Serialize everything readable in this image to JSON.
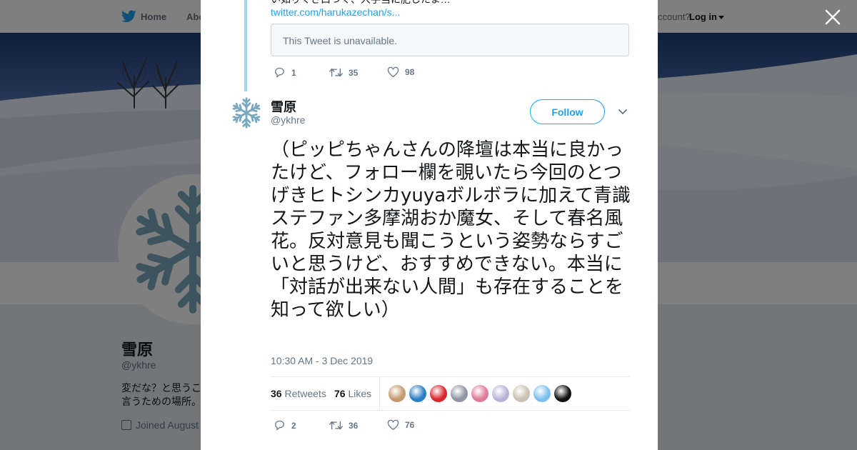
{
  "topbar": {
    "home_label": "Home",
    "about_label": "Abo",
    "account_text": "ccount?",
    "login_label": "Log in"
  },
  "profile": {
    "name": "雪原",
    "handle": "@ykhre",
    "bio": "変だな？と思うこ\n言うための場所。",
    "joined": "Joined August"
  },
  "previous_tweet": {
    "text_partial": "い如りくさ口つく、人手当に肥したま…",
    "link": "twitter.com/harukazechan/s...",
    "unavailable_text": "This Tweet is unavailable.",
    "replies": "1",
    "retweets": "35",
    "likes": "98"
  },
  "tweet": {
    "name": "雪原",
    "handle": "@ykhre",
    "follow_label": "Follow",
    "text": "（ピッピちゃんさんの降壇は本当に良かったけど、フォロー欄を覗いたら今回のとつげきヒトシンカyuyaボルボラに加えて青識ステファン多摩湖おか魔女、そして春名風花。反対意見も聞こうという姿勢ならすごいと思うけど、おすすめできない。本当に「対話が出来ない人間」も存在することを知って欲しい）",
    "timestamp": "10:30 AM - 3 Dec 2019",
    "retweets_count": "36",
    "retweets_label": "Retweets",
    "likes_count": "76",
    "likes_label": "Likes",
    "replies": "2",
    "retweets": "36",
    "likes": "76"
  },
  "likers": [
    {
      "name": "liker-1",
      "color": "#c49a6c"
    },
    {
      "name": "liker-2",
      "color": "#2b7fc4"
    },
    {
      "name": "liker-3",
      "color": "#d8262c"
    },
    {
      "name": "liker-4",
      "color": "#8f96a3"
    },
    {
      "name": "liker-5",
      "color": "#e07a9a"
    },
    {
      "name": "liker-6",
      "color": "#b8b3d6"
    },
    {
      "name": "liker-7",
      "color": "#c9c2b4"
    },
    {
      "name": "liker-8",
      "color": "#7cc0ee"
    },
    {
      "name": "liker-9",
      "color": "#111111"
    }
  ],
  "colors": {
    "accent": "#1da1f2",
    "text": "#14171a",
    "muted": "#657786",
    "thread": "#a3d6f5",
    "snowflake": "#7aa8bf"
  }
}
